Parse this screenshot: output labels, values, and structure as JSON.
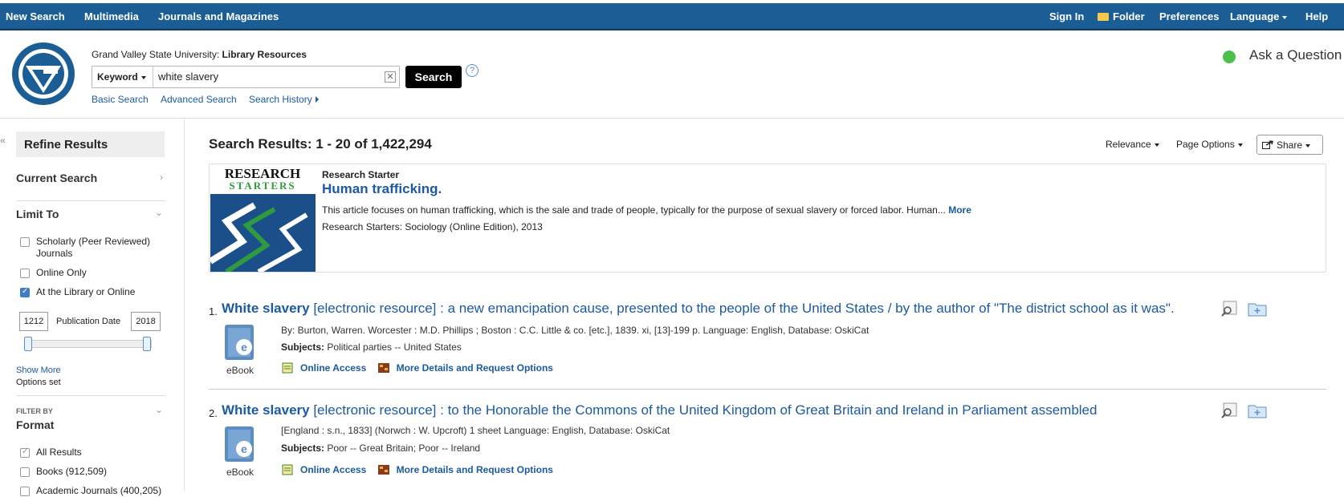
{
  "topnav": {
    "new_search": "New Search",
    "multimedia": "Multimedia",
    "journals": "Journals and Magazines",
    "sign_in": "Sign In",
    "folder": "Folder",
    "preferences": "Preferences",
    "language": "Language",
    "help": "Help"
  },
  "header": {
    "institution": "Grand Valley State University:",
    "resources": "Library Resources",
    "field_select": "Keyword",
    "query": "white slavery",
    "search_button": "Search",
    "help_icon": "?",
    "basic_search": "Basic Search",
    "advanced_search": "Advanced Search",
    "search_history": "Search History",
    "ask_question": "Ask a Question",
    "status_color": "#4cc04c"
  },
  "sidebar": {
    "collapse": "«",
    "refine": "Refine Results",
    "current_search": "Current Search",
    "limit_to": "Limit To",
    "scholarly": "Scholarly (Peer Reviewed)",
    "scholarly2": "Journals",
    "online_only": "Online Only",
    "library_online": "At the Library or Online",
    "date_from": "1212",
    "date_label": "Publication Date",
    "date_to": "2018",
    "show_more": "Show More",
    "options_set": "Options set",
    "filter_by": "FILTER BY",
    "format": "Format",
    "all_results": "All Results",
    "books": "Books (912,509)",
    "academic": "Academic Journals (400,205)"
  },
  "results": {
    "heading": "Search Results:",
    "range": "1 - 20 of 1,422,294",
    "relevance": "Relevance",
    "page_options": "Page Options",
    "share": "Share"
  },
  "research_starter": {
    "logo_line1": "RESEARCH",
    "logo_line2": "STARTERS",
    "label": "Research Starter",
    "title": "Human trafficking.",
    "abstract": "This article focuses on human trafficking, which is the sale and trade of people, typically for the purpose of sexual slavery or forced labor. Human...",
    "more": "More",
    "source": "Research Starters: Sociology (Online Edition), 2013"
  },
  "records": [
    {
      "num": "1.",
      "title_bold": "White slavery",
      "title_rest": " [electronic resource] : a new emancipation cause, presented to the people of the United States / by the author of \"The district school as it was\".",
      "byline": "By: Burton, Warren. Worcester : M.D. Phillips ; Boston : C.C. Little & co. [etc.], 1839. xi, [13]-199 p. Language: English, Database: OskiCat",
      "subjects_label": "Subjects:",
      "subjects": " Political parties -- United States",
      "type": "eBook",
      "online_access": "Online Access",
      "more_details": "More Details and Request Options"
    },
    {
      "num": "2.",
      "title_bold": "White slavery",
      "title_rest": " [electronic resource] : to the Honorable the Commons of the United Kingdom of Great Britain and Ireland in Parliament assembled",
      "byline": "[England : s.n., 1833] (Norwch : W. Upcroft) 1 sheet Language: English, Database: OskiCat",
      "subjects_label": "Subjects:",
      "subjects": " Poor -- Great Britain; Poor -- Ireland",
      "type": "eBook",
      "online_access": "Online Access",
      "more_details": "More Details and Request Options"
    }
  ]
}
